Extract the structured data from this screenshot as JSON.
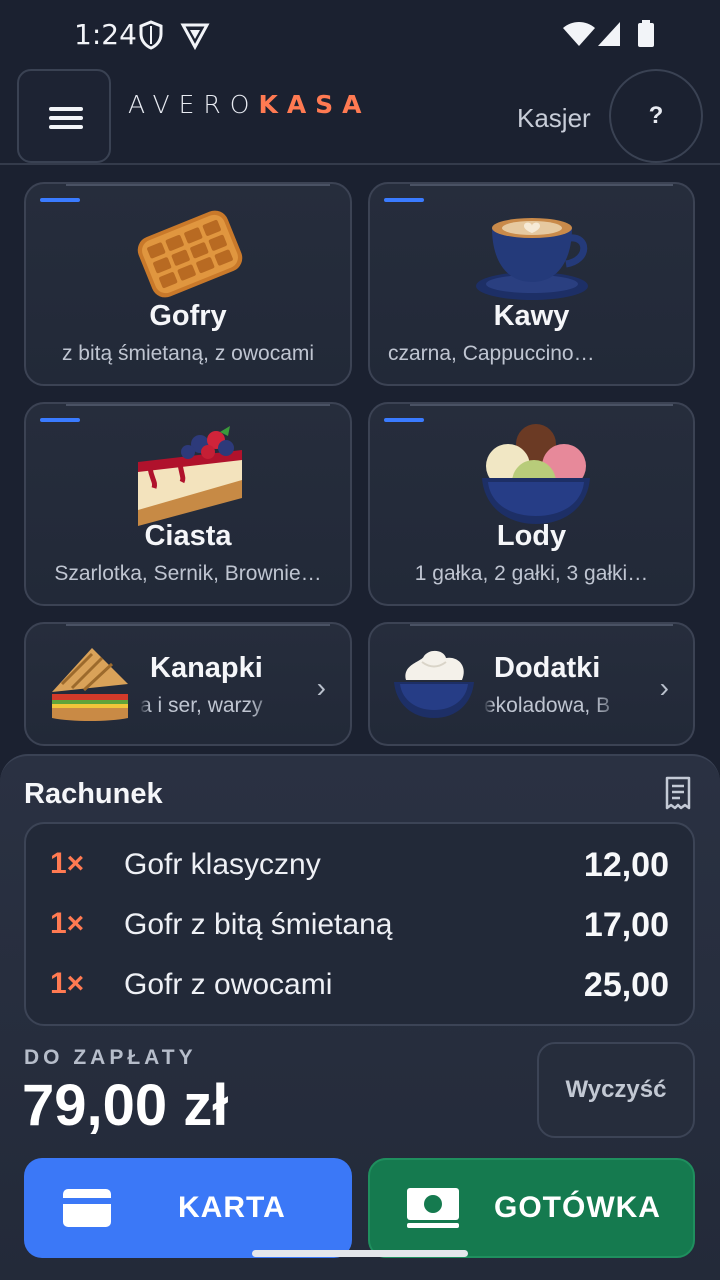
{
  "status_bar": {
    "time": "1:24"
  },
  "app": {
    "logo_part1": "AVERO",
    "logo_part2": "KASA",
    "role": "Kasjer",
    "help_label": "?"
  },
  "categories": [
    {
      "title": "Gofry",
      "subtitle": "z bitą śmietaną, z owocami"
    },
    {
      "title": "Kawy",
      "subtitle": "czarna, Cappuccino…"
    },
    {
      "title": "Ciasta",
      "subtitle": "Szarlotka, Sernik, Brownie…"
    },
    {
      "title": "Lody",
      "subtitle": "1 gałka, 2 gałki, 3 gałki…"
    },
    {
      "title": "Kanapki",
      "subtitle": "a i ser, warzy"
    },
    {
      "title": "Dodatki",
      "subtitle": "ekoladowa, B"
    }
  ],
  "bill": {
    "title": "Rachunek",
    "items": [
      {
        "qty": "1×",
        "name": "Gofr klasyczny",
        "price": "12,00"
      },
      {
        "qty": "1×",
        "name": "Gofr z bitą śmietaną",
        "price": "17,00"
      },
      {
        "qty": "1×",
        "name": "Gofr z owocami",
        "price": "25,00"
      }
    ],
    "due_label": "DO ZAPŁATY",
    "due_value": "79,00 zł",
    "clear_label": "Wyczyść"
  },
  "payment": {
    "card_label": "KARTA",
    "cash_label": "GOTÓWKA"
  },
  "colors": {
    "accent_orange": "#ff7a52",
    "card_blue": "#3b78f7",
    "cash_green": "#157a4f",
    "background": "#1b2130"
  }
}
